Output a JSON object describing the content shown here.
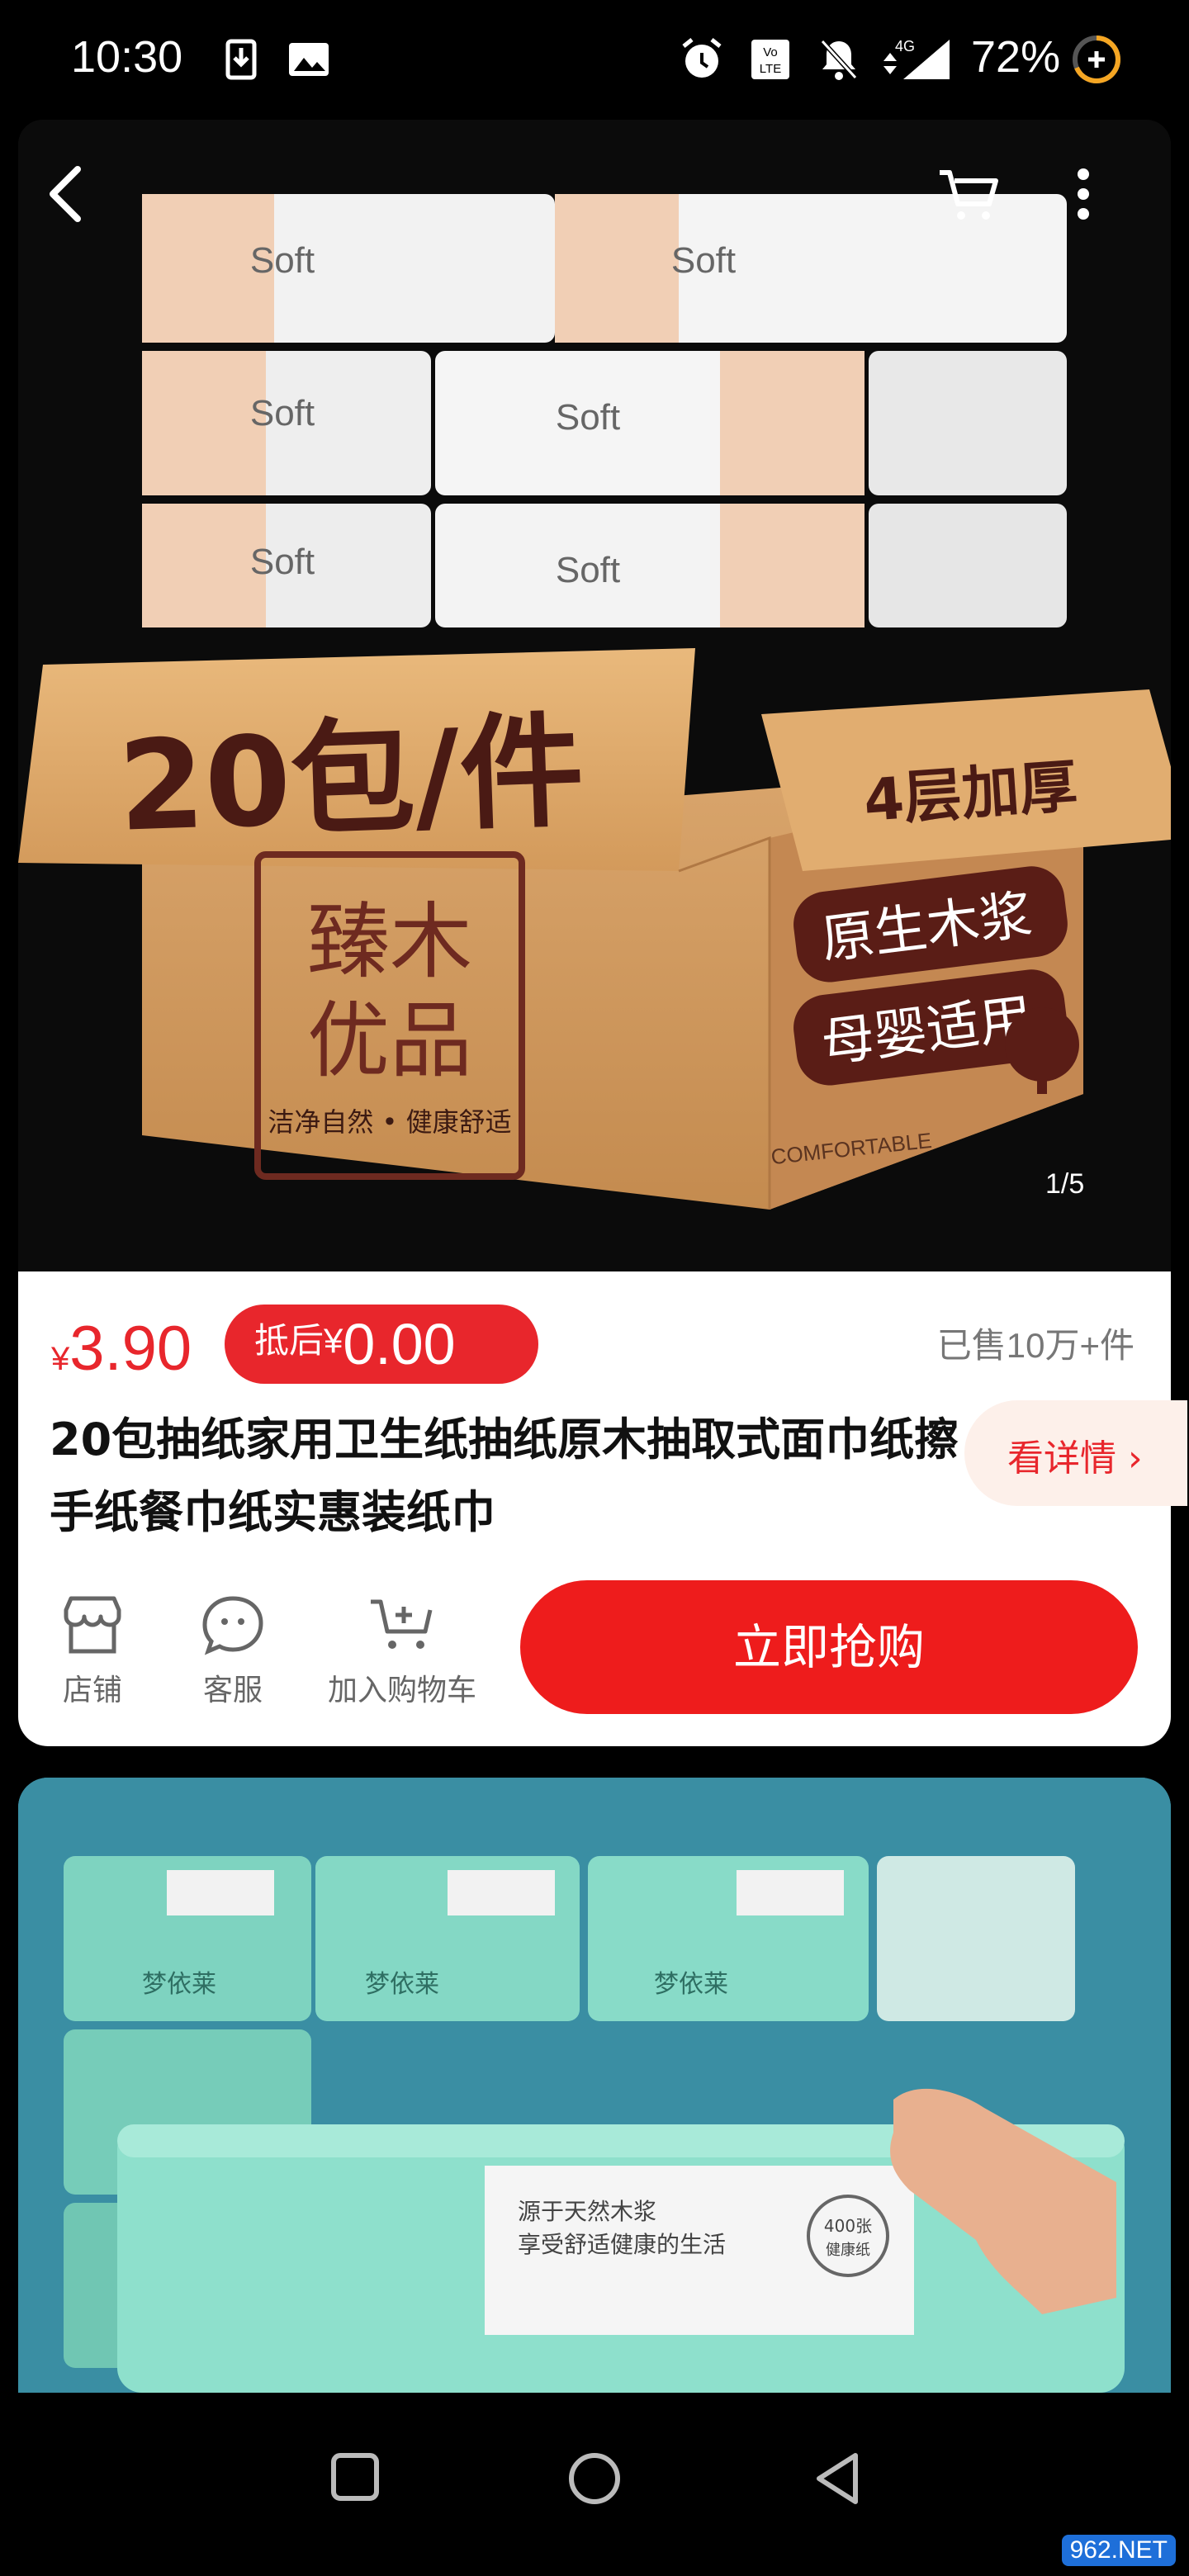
{
  "status_bar": {
    "time": "10:30",
    "battery": "72%",
    "network": "4G"
  },
  "hero": {
    "page_indicator": "1/5",
    "box_text_main": "20包/件",
    "box_text_side": "4层加厚",
    "brand_line1": "臻木",
    "brand_line2": "优品",
    "slogan": "洁净自然 • 健康舒适",
    "feature1": "原生木浆",
    "feature2": "母婴适用",
    "comfortable": "COMFORTABLE",
    "tissue_label": "Soft"
  },
  "product": {
    "price_symbol": "¥",
    "price": "3.90",
    "coupon_label": "抵后¥",
    "coupon_price": "0.00",
    "sold": "已售10万+件",
    "title": "20包抽纸家用卫生纸抽纸原木抽取式面巾纸擦手纸餐巾纸实惠装纸巾",
    "detail_button": "看详情 ›",
    "actions": {
      "store": "店铺",
      "service": "客服",
      "cart": "加入购物车"
    },
    "buy_button": "立即抢购"
  },
  "second_image": {
    "brand": "梦依莱",
    "label_line1": "源于天然木浆",
    "label_line2": "享受舒适健康的生活",
    "badge": "400张",
    "badge_sub": "健康纸"
  },
  "watermark": "962.NET",
  "colors": {
    "accent": "#e8262c",
    "buy_button": "#ee1c1c",
    "background": "#000000",
    "card": "#ffffff"
  }
}
